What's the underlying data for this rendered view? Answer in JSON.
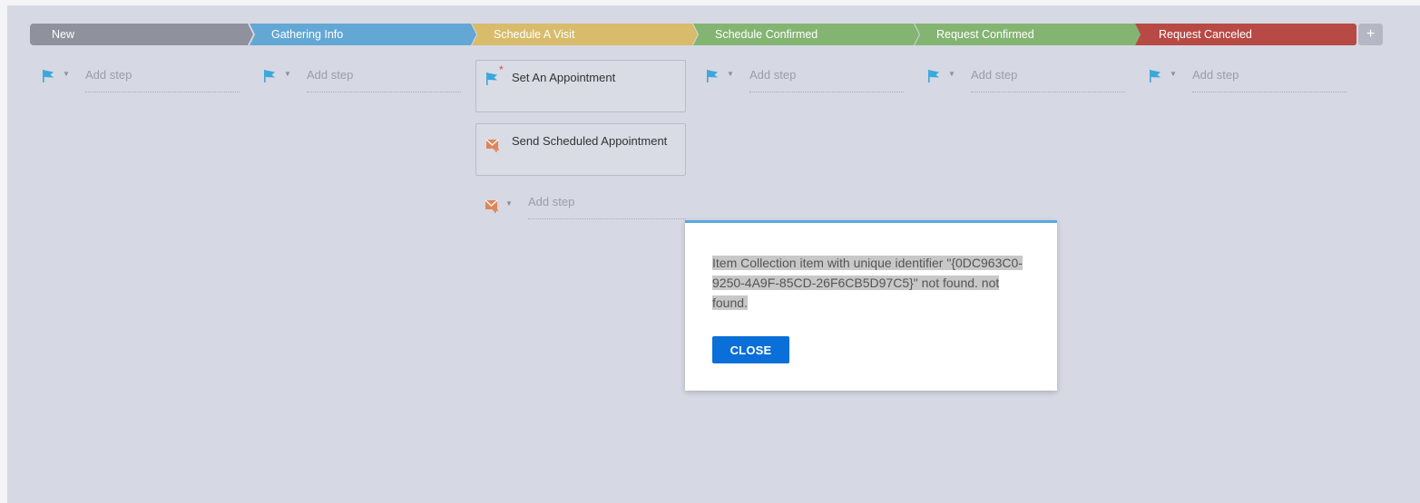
{
  "stages": [
    {
      "label": "New",
      "color": "#8f929d"
    },
    {
      "label": "Gathering Info",
      "color": "#63a7d4"
    },
    {
      "label": "Schedule A Visit",
      "color": "#d8bc6c"
    },
    {
      "label": "Schedule Confirmed",
      "color": "#84b472"
    },
    {
      "label": "Request Confirmed",
      "color": "#84b472"
    },
    {
      "label": "Request Canceled",
      "color": "#b84a45"
    }
  ],
  "add_stage_label": "+",
  "add_step_placeholder": "Add step",
  "cards": [
    {
      "label": "Set An Appointment",
      "icon": "flag-required-icon"
    },
    {
      "label": "Send Scheduled Appointment",
      "icon": "email-task-icon"
    }
  ],
  "modal": {
    "message": "Item Collection item with unique identifier \"{0DC963C0-9250-4A9F-85CD-26F6CB5D97C5}\" not found. not found.",
    "close_label": "CLOSE"
  },
  "colors": {
    "flag": "#3ba7db",
    "email_icon": "#e0865a",
    "modal_accent": "#58a9e0",
    "close_button": "#0a6fd8"
  }
}
